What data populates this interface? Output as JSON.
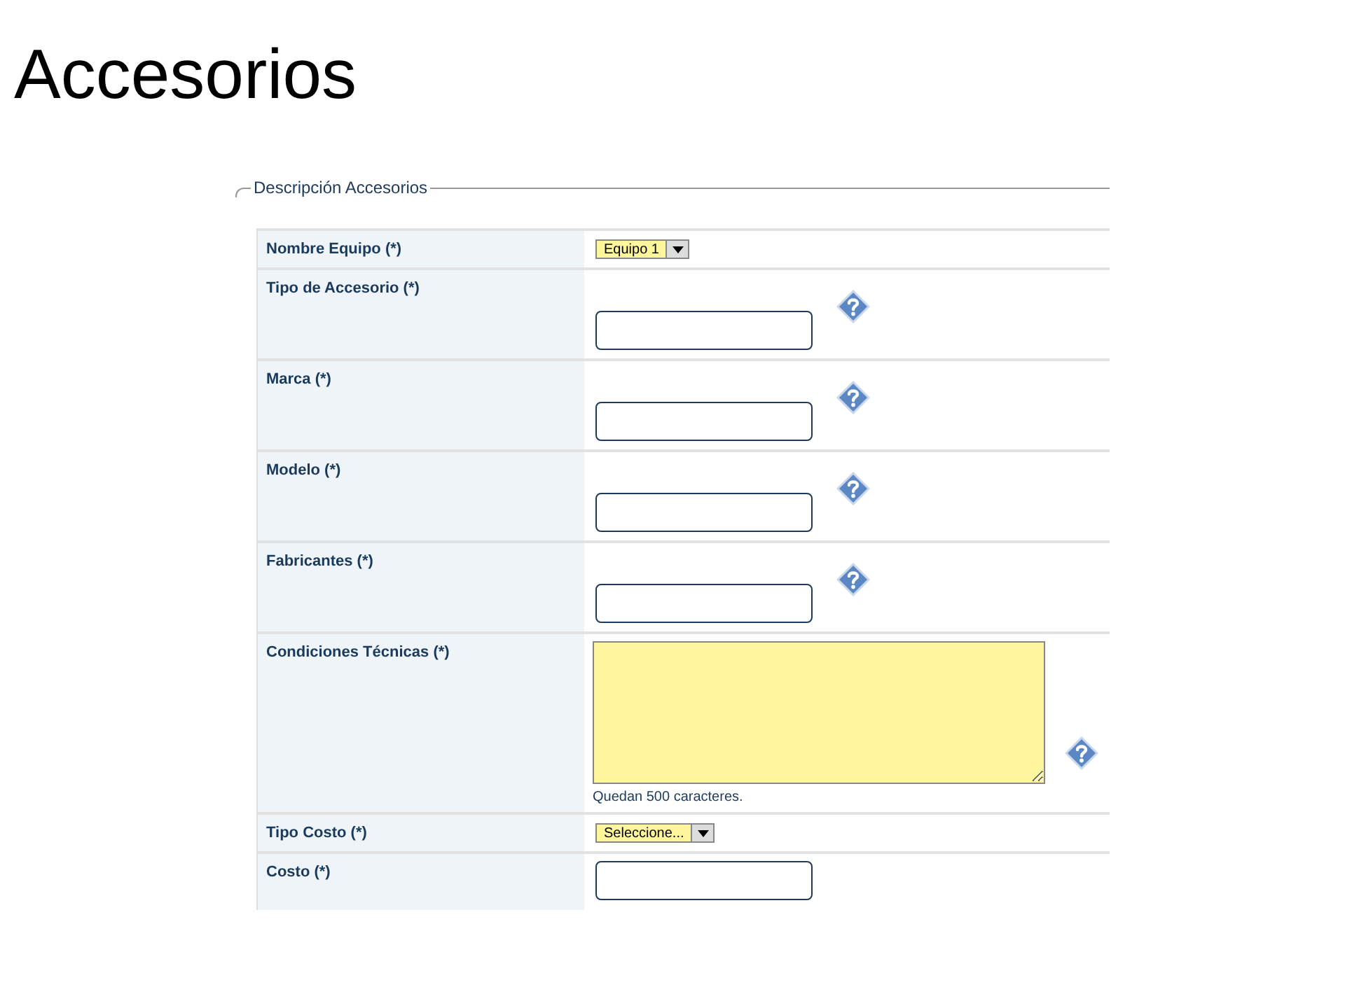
{
  "title": "Accesorios",
  "fieldset": {
    "legend": "Descripción Accesorios",
    "rows": [
      {
        "kind": "select",
        "label": "Nombre Equipo (*)",
        "value": "Equipo 1"
      },
      {
        "kind": "text",
        "label": "Tipo de Accesorio (*)",
        "help": true
      },
      {
        "kind": "text",
        "label": "Marca (*)",
        "help": true
      },
      {
        "kind": "text",
        "label": "Modelo (*)",
        "help": true
      },
      {
        "kind": "text",
        "label": "Fabricantes (*)",
        "help": true
      },
      {
        "kind": "textarea",
        "label": "Condiciones Técnicas (*)",
        "help": true,
        "counter": "Quedan 500 caracteres."
      },
      {
        "kind": "select",
        "label": "Tipo Costo (*)",
        "value": "Seleccione..."
      },
      {
        "kind": "text",
        "label": "Costo (*)",
        "help": false
      }
    ]
  }
}
